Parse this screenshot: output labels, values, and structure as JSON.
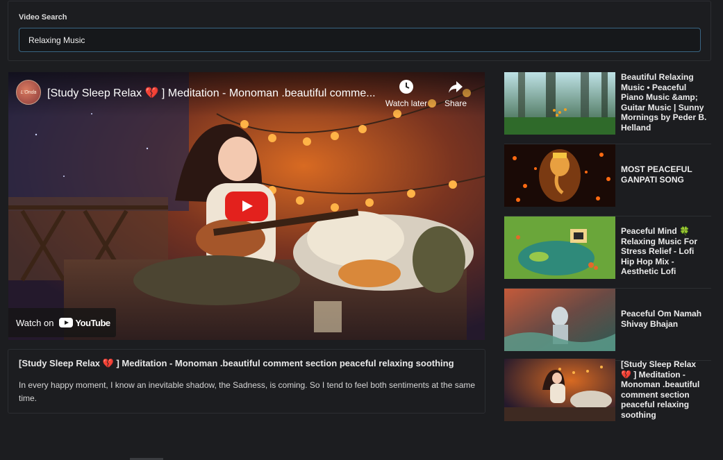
{
  "search": {
    "label": "Video Search",
    "value": "Relaxing Music"
  },
  "player": {
    "channel_avatar_text": "L'Onda",
    "title": "[Study Sleep Relax 💔 ] Meditation - Monoman .beautiful comme...",
    "watch_later_label": "Watch later",
    "share_label": "Share",
    "watch_on_label": "Watch on",
    "youtube_wordmark": "YouTube"
  },
  "selected": {
    "title": "[Study Sleep Relax 💔 ] Meditation - Monoman .beautiful comment section peaceful relaxing soothing",
    "description": "In every happy moment, I know an inevitable shadow, the Sadness, is coming. So I tend to feel both sentiments at the same time."
  },
  "results": [
    {
      "title": "Beautiful Relaxing Music • Peaceful Piano Music &amp; Guitar Music | Sunny Mornings by Peder B. Helland",
      "thumb": "forest"
    },
    {
      "title": "MOST PEACEFUL GANPATI SONG",
      "thumb": "ganesha"
    },
    {
      "title": "Peaceful Mind 🍀 Relaxing Music For Stress Relief - Lofi Hip Hop Mix - Aesthetic Lofi",
      "thumb": "lofi-pond"
    },
    {
      "title": "Peaceful Om Namah Shivay Bhajan",
      "thumb": "shiva"
    },
    {
      "title": "[Study Sleep Relax 💔 ] Meditation - Monoman .beautiful comment section peaceful relaxing soothing",
      "thumb": "guitar-girl"
    }
  ],
  "colors": {
    "background": "#1c1d20",
    "input_border": "#3a6684",
    "play_red": "#e3211d"
  }
}
